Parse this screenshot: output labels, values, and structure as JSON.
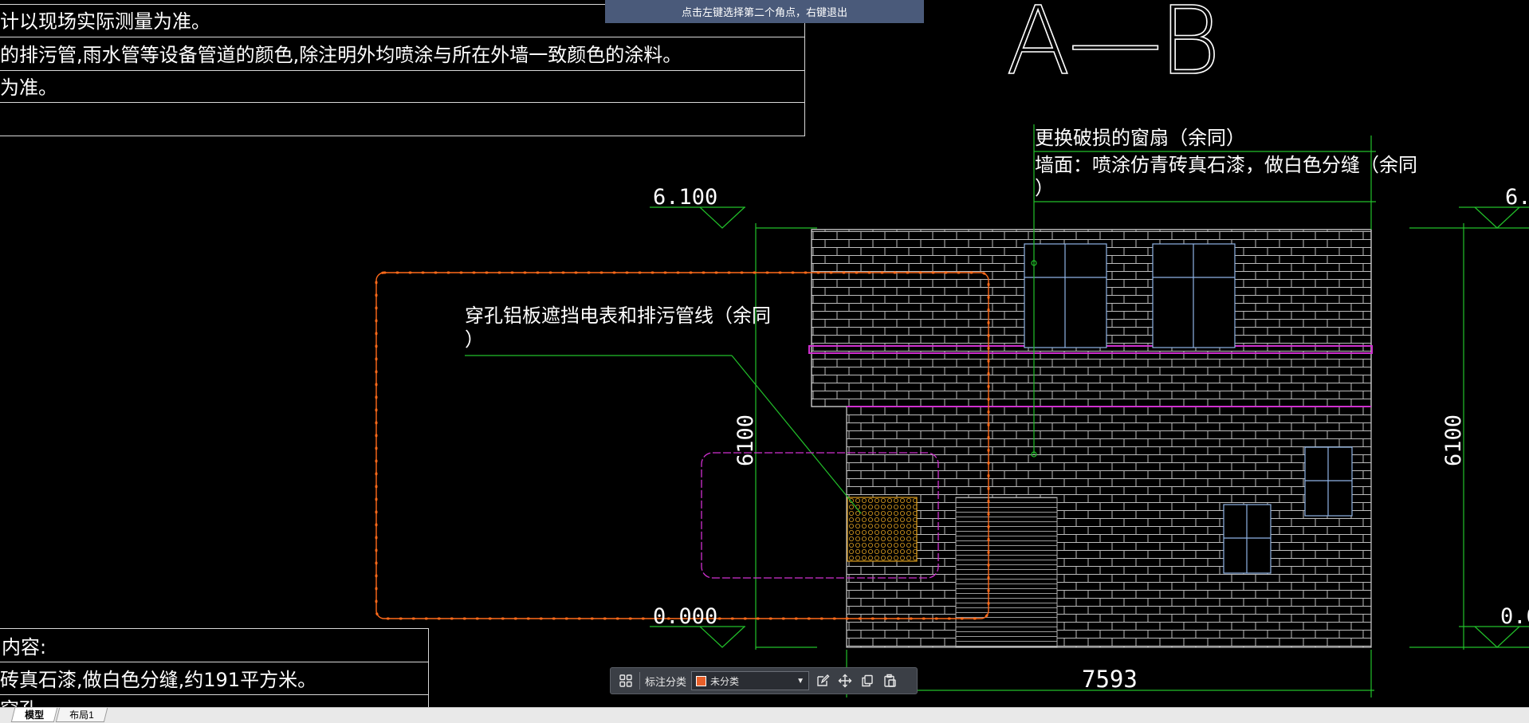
{
  "prompt": {
    "text": "点击左键选择第二个角点，右键退出"
  },
  "notes_top": [
    "计以现场实际测量为准。",
    "的排污管,雨水管等设备管道的颜色,除注明外均喷涂与所在外墙一致颜色的涂料。",
    "为准。"
  ],
  "notes_bottom": [
    "内容:",
    "砖真石漆,做白色分缝,约191平方米。",
    "穿孔"
  ],
  "drawing": {
    "title": "A—B",
    "window_note": "更换破损的窗扇（余同）",
    "wall_note_line1": "墙面：喷涂仿青砖真石漆，做白色分缝（余同",
    "wall_note_line2": "）",
    "panel_note_line1": "穿孔铝板遮挡电表和排污管线（余同",
    "panel_note_line2": "）",
    "level_top": "6.100",
    "level_bottom": "0.000",
    "level_top_right": "6.",
    "level_bottom_right": "0.0",
    "height_left": "6100",
    "height_right": "6100",
    "width_dim": "7593"
  },
  "toolbar": {
    "category_label": "标注分类",
    "category_value": "未分类",
    "icons": [
      "grid-icon",
      "edit-icon",
      "move-icon",
      "copy-icon",
      "paste-icon"
    ]
  },
  "tabs": [
    {
      "label": "模型",
      "active": true
    },
    {
      "label": "布局1",
      "active": false
    }
  ],
  "colors": {
    "background": "#000000",
    "brick": "#c8c8c8",
    "dimension": "#22c02a",
    "revision_cloud": "#ff6a1a",
    "magenta": "#d030d0",
    "window": "#8fb4e6",
    "banner": "#4a5a7a"
  }
}
